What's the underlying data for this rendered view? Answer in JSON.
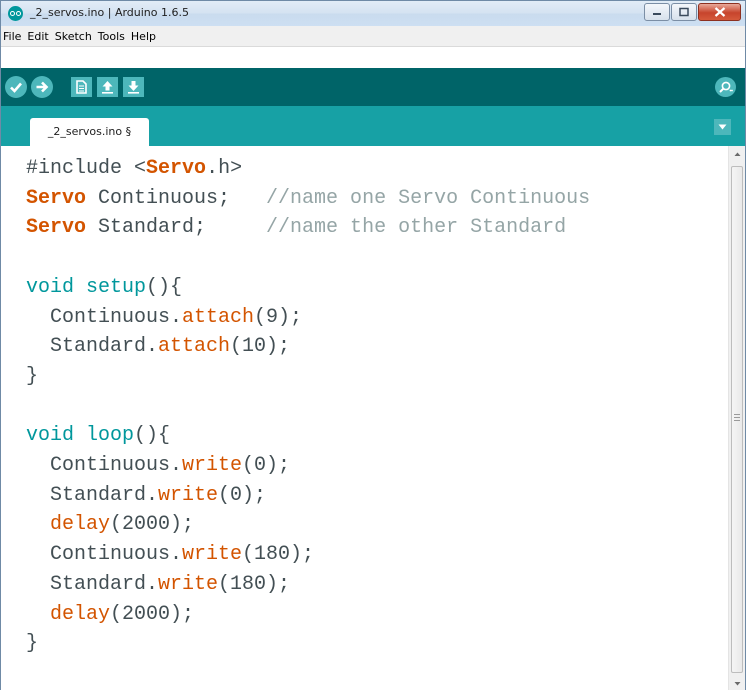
{
  "window": {
    "title": "_2_servos.ino | Arduino 1.6.5",
    "controls": [
      "minimize",
      "maximize",
      "close"
    ]
  },
  "menu": [
    "File",
    "Edit",
    "Sketch",
    "Tools",
    "Help"
  ],
  "toolbar": {
    "buttons": [
      "verify-icon",
      "upload-icon",
      "new-icon",
      "open-icon",
      "save-icon"
    ],
    "right_button": "serial-monitor-icon"
  },
  "tabs": [
    {
      "label": "_2_servos.ino §",
      "active": true
    }
  ],
  "colors": {
    "toolbar": "#006468",
    "tabbar": "#17a1a5",
    "button": "#4db7bb",
    "keyword": "#d35400",
    "type": "#00979c",
    "comment": "#95a5a6",
    "text": "#434f54"
  },
  "code": [
    [
      [
        "#include ",
        "p"
      ],
      [
        "<",
        "p"
      ],
      [
        "Servo",
        "kw"
      ],
      [
        ".h>",
        "p"
      ]
    ],
    [
      [
        "Servo",
        "kw"
      ],
      [
        " Continuous;   ",
        "p"
      ],
      [
        "//name one Servo Continuous",
        "cm"
      ]
    ],
    [
      [
        "Servo",
        "kw"
      ],
      [
        " Standard;     ",
        "p"
      ],
      [
        "//name the other Standard",
        "cm"
      ]
    ],
    [],
    [
      [
        "void",
        "ty"
      ],
      [
        " ",
        "p"
      ],
      [
        "setup",
        "ty"
      ],
      [
        "(){",
        "p"
      ]
    ],
    [
      [
        "  Continuous.",
        "p"
      ],
      [
        "attach",
        "fn"
      ],
      [
        "(9);",
        "p"
      ]
    ],
    [
      [
        "  Standard.",
        "p"
      ],
      [
        "attach",
        "fn"
      ],
      [
        "(10);",
        "p"
      ]
    ],
    [
      [
        "}",
        "p"
      ]
    ],
    [],
    [
      [
        "void",
        "ty"
      ],
      [
        " ",
        "p"
      ],
      [
        "loop",
        "ty"
      ],
      [
        "(){",
        "p"
      ]
    ],
    [
      [
        "  Continuous.",
        "p"
      ],
      [
        "write",
        "fn"
      ],
      [
        "(0);",
        "p"
      ]
    ],
    [
      [
        "  Standard.",
        "p"
      ],
      [
        "write",
        "fn"
      ],
      [
        "(0);",
        "p"
      ]
    ],
    [
      [
        "  ",
        "p"
      ],
      [
        "delay",
        "fn"
      ],
      [
        "(2000);",
        "p"
      ]
    ],
    [
      [
        "  Continuous.",
        "p"
      ],
      [
        "write",
        "fn"
      ],
      [
        "(180);",
        "p"
      ]
    ],
    [
      [
        "  Standard.",
        "p"
      ],
      [
        "write",
        "fn"
      ],
      [
        "(180);",
        "p"
      ]
    ],
    [
      [
        "  ",
        "p"
      ],
      [
        "delay",
        "fn"
      ],
      [
        "(2000);",
        "p"
      ]
    ],
    [
      [
        "}",
        "p"
      ]
    ]
  ]
}
